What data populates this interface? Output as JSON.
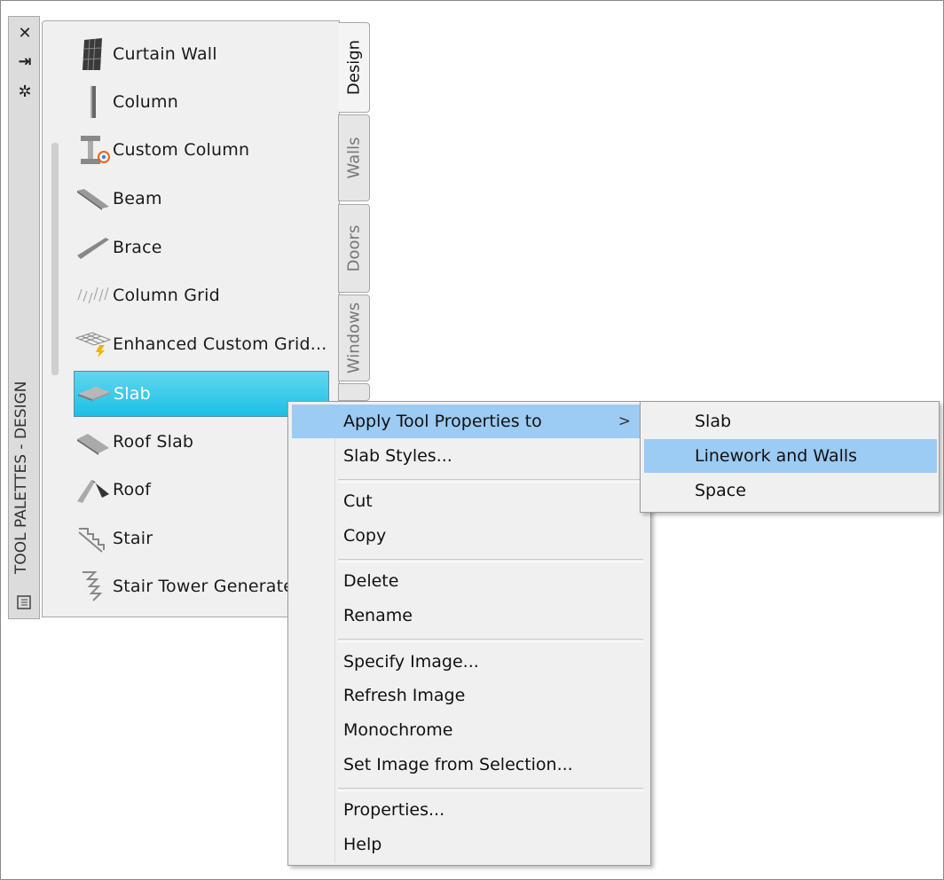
{
  "palette": {
    "title": "TOOL PALETTES - DESIGN",
    "controls": {
      "close": "✕",
      "autohide": "⇥",
      "properties": "✲"
    },
    "tabs": [
      {
        "label": "Design",
        "active": true
      },
      {
        "label": "Walls",
        "active": false
      },
      {
        "label": "Doors",
        "active": false
      },
      {
        "label": "Windows",
        "active": false
      },
      {
        "label": "",
        "active": false
      }
    ],
    "tools": [
      {
        "label": "Curtain Wall",
        "icon": "curtain-wall-icon"
      },
      {
        "label": "Column",
        "icon": "column-icon"
      },
      {
        "label": "Custom Column",
        "icon": "custom-column-icon"
      },
      {
        "label": "Beam",
        "icon": "beam-icon"
      },
      {
        "label": "Brace",
        "icon": "brace-icon"
      },
      {
        "label": "Column Grid",
        "icon": "column-grid-icon"
      },
      {
        "label": "Enhanced Custom Grid...",
        "icon": "enhanced-custom-grid-icon"
      },
      {
        "label": "Slab",
        "icon": "slab-icon",
        "selected": true
      },
      {
        "label": "Roof Slab",
        "icon": "roof-slab-icon"
      },
      {
        "label": "Roof",
        "icon": "roof-icon"
      },
      {
        "label": "Stair",
        "icon": "stair-icon"
      },
      {
        "label": "Stair Tower Generate",
        "icon": "stair-tower-icon"
      }
    ]
  },
  "context_menu": {
    "items": [
      {
        "label": "Apply Tool Properties to",
        "submenu_arrow": ">"
      },
      {
        "label": "Slab Styles..."
      },
      {
        "label": "Cut"
      },
      {
        "label": "Copy"
      },
      {
        "label": "Delete"
      },
      {
        "label": "Rename"
      },
      {
        "label": "Specify Image..."
      },
      {
        "label": "Refresh Image"
      },
      {
        "label": "Monochrome"
      },
      {
        "label": "Set Image from Selection..."
      },
      {
        "label": "Properties..."
      },
      {
        "label": "Help"
      }
    ]
  },
  "submenu": {
    "items": [
      {
        "label": "Slab"
      },
      {
        "label": "Linework and Walls"
      },
      {
        "label": "Space"
      }
    ]
  },
  "colors": {
    "selection": "#1bc0e6",
    "menu_hover": "#9ccbf4"
  }
}
